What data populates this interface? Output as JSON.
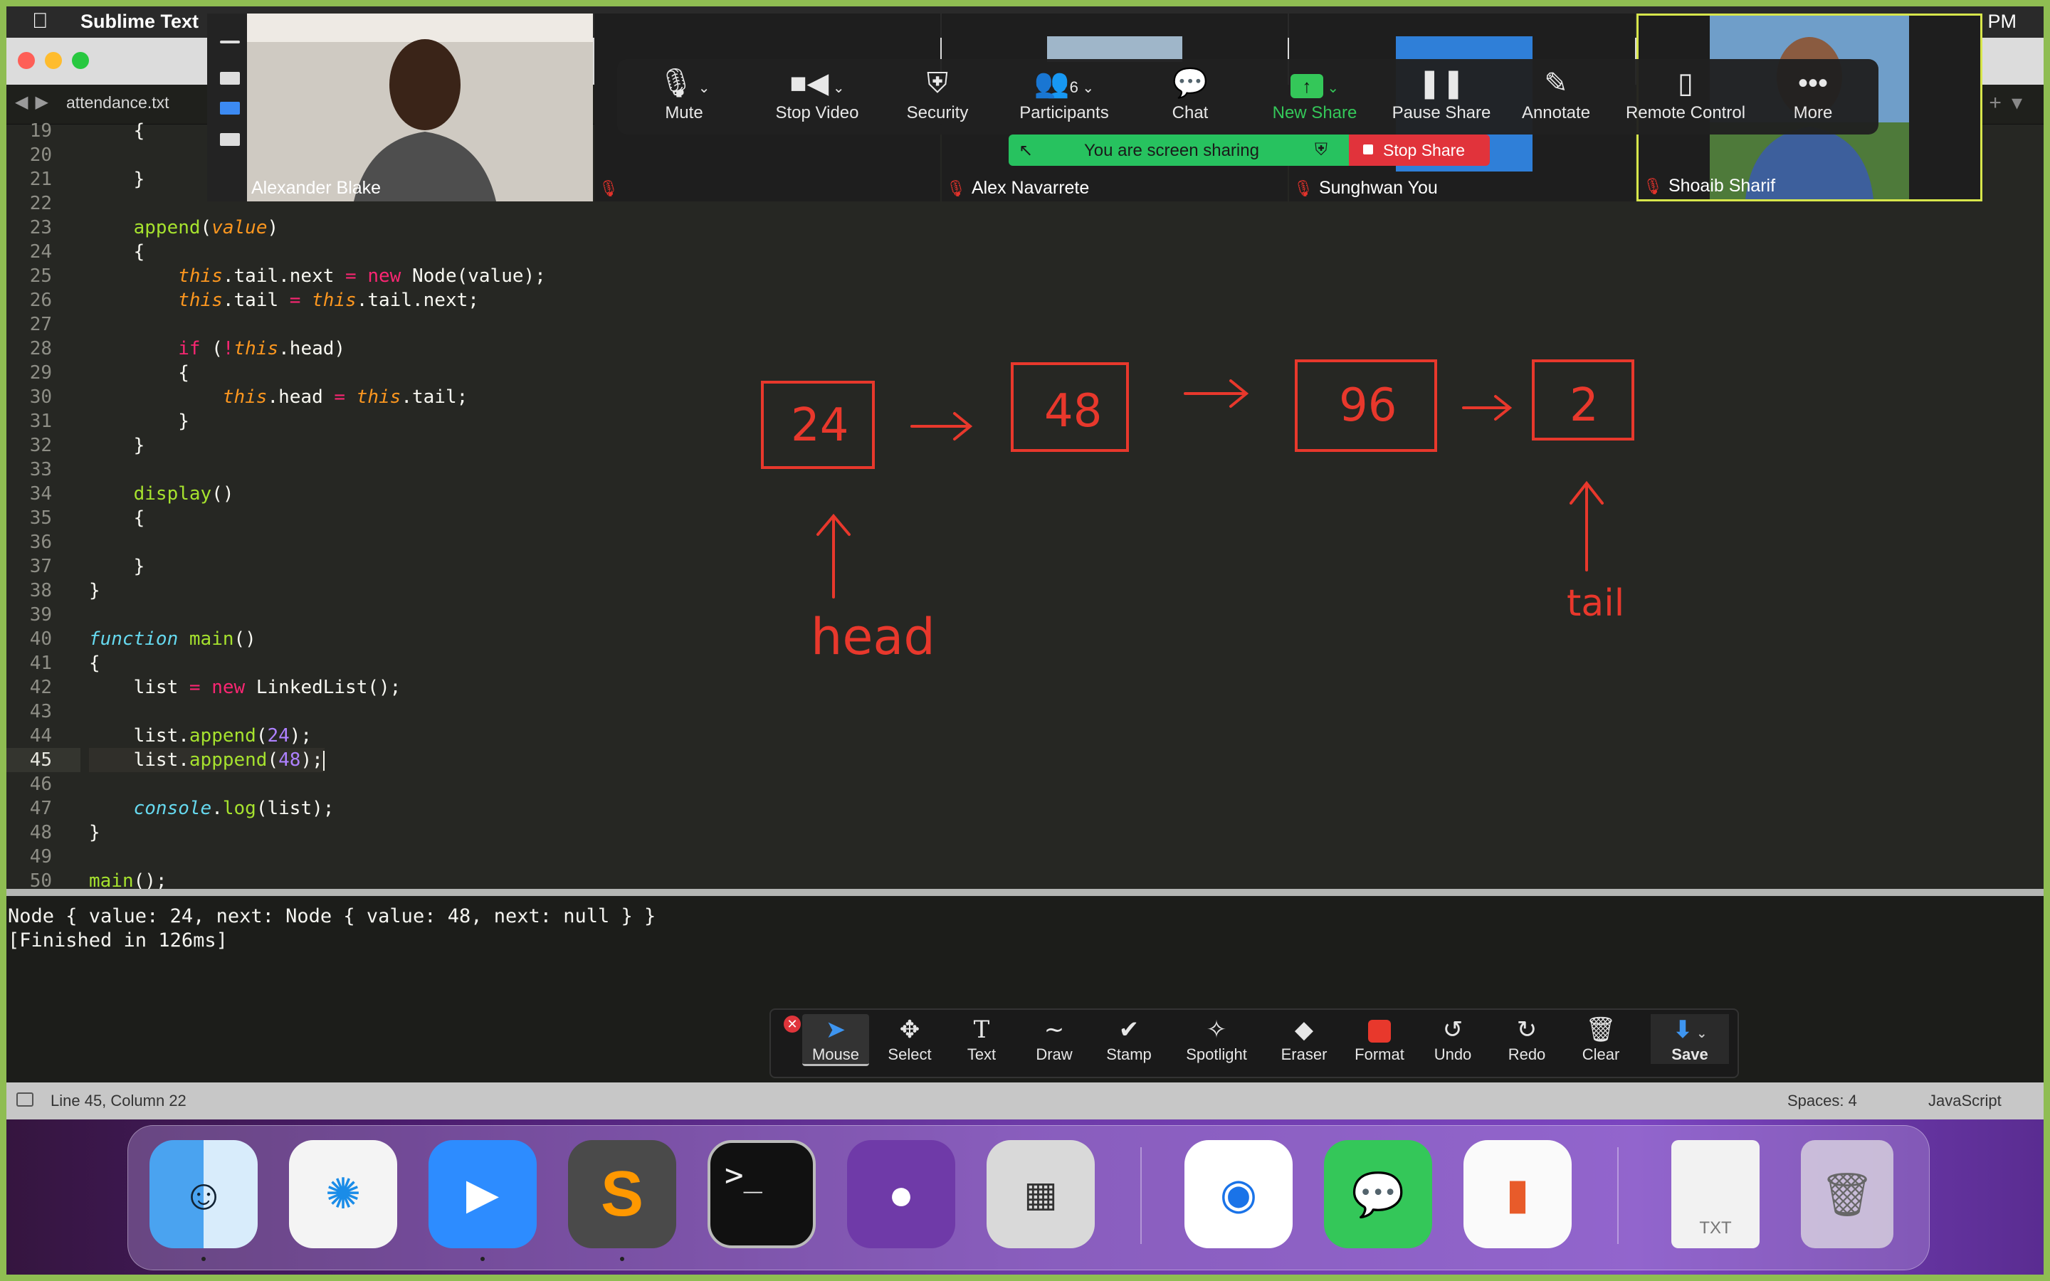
{
  "menubar": {
    "app_name": "Sublime Text",
    "clock": "3 PM"
  },
  "editor_tab": {
    "filename": "attendance.txt"
  },
  "code_lines": [
    {
      "n": "19",
      "html": "    {"
    },
    {
      "n": "20",
      "html": ""
    },
    {
      "n": "21",
      "html": "    }"
    },
    {
      "n": "22",
      "html": ""
    },
    {
      "n": "23",
      "html": "    <span class=\"fn\">append</span>(<span class=\"pa\">value</span>)"
    },
    {
      "n": "24",
      "html": "    {"
    },
    {
      "n": "25",
      "html": "        <span class=\"th\">this</span>.tail.next <span class=\"k\">=</span> <span class=\"k\">new</span> Node(value);"
    },
    {
      "n": "26",
      "html": "        <span class=\"th\">this</span>.tail <span class=\"k\">=</span> <span class=\"th\">this</span>.tail.next;"
    },
    {
      "n": "27",
      "html": ""
    },
    {
      "n": "28",
      "html": "        <span class=\"k\">if</span> (<span class=\"k\">!</span><span class=\"th\">this</span>.head)"
    },
    {
      "n": "29",
      "html": "        {"
    },
    {
      "n": "30",
      "html": "            <span class=\"th\">this</span>.head <span class=\"k\">=</span> <span class=\"th\">this</span>.tail;"
    },
    {
      "n": "31",
      "html": "        }"
    },
    {
      "n": "32",
      "html": "    }"
    },
    {
      "n": "33",
      "html": ""
    },
    {
      "n": "34",
      "html": "    <span class=\"fn\">display</span>()"
    },
    {
      "n": "35",
      "html": "    {"
    },
    {
      "n": "36",
      "html": ""
    },
    {
      "n": "37",
      "html": "    }"
    },
    {
      "n": "38",
      "html": "}"
    },
    {
      "n": "39",
      "html": ""
    },
    {
      "n": "40",
      "html": "<span class=\"it\">function</span> <span class=\"fn\">main</span>()"
    },
    {
      "n": "41",
      "html": "{"
    },
    {
      "n": "42",
      "html": "    list <span class=\"k\">=</span> <span class=\"k\">new</span> LinkedList();"
    },
    {
      "n": "43",
      "html": ""
    },
    {
      "n": "44",
      "html": "    list.<span class=\"fn\">append</span>(<span class=\"num\">24</span>);"
    },
    {
      "n": "45",
      "html": "    list.<span class=\"fn\">apppend</span>(<span class=\"num\">48</span>);<span class=\"cursor\"></span>"
    },
    {
      "n": "46",
      "html": ""
    },
    {
      "n": "47",
      "html": "    <span class=\"it\">console</span>.<span class=\"fn\">log</span>(list);"
    },
    {
      "n": "48",
      "html": "}"
    },
    {
      "n": "49",
      "html": ""
    },
    {
      "n": "50",
      "html": "<span class=\"fn\">main</span>();"
    }
  ],
  "current_line": "45",
  "output": {
    "line1": "Node { value: 24, next: Node { value: 48, next: null } }",
    "line2": "[Finished in 126ms]"
  },
  "statusbar": {
    "position": "Line 45, Column 22",
    "spaces": "Spaces: 4",
    "syntax": "JavaScript"
  },
  "drawing": {
    "nodes": [
      "24",
      "48",
      "96",
      "2"
    ],
    "head_label": "head",
    "tail_label": "tail",
    "ink_color": "#e8382c"
  },
  "participants": {
    "p1": "Alexander Blake",
    "p2": "Alex Navarrete",
    "p3": "Sunghwan You",
    "p4": "Shoaib Sharif",
    "count": "6"
  },
  "zoom_toolbar": {
    "mute": "Mute",
    "stop_video": "Stop Video",
    "security": "Security",
    "participants": "Participants",
    "chat": "Chat",
    "new_share": "New Share",
    "pause_share": "Pause Share",
    "annotate": "Annotate",
    "remote_control": "Remote Control",
    "more": "More"
  },
  "share_status": {
    "sharing": "You are screen sharing",
    "stop_share": "Stop Share"
  },
  "annotation_toolbar": {
    "mouse": "Mouse",
    "select": "Select",
    "text": "Text",
    "draw": "Draw",
    "stamp": "Stamp",
    "spotlight": "Spotlight",
    "eraser": "Eraser",
    "format": "Format",
    "undo": "Undo",
    "redo": "Redo",
    "clear": "Clear",
    "save": "Save"
  },
  "dock": {
    "txt_label": "TXT"
  },
  "colors": {
    "zoom_green": "#34c759",
    "stop_red": "#e1333b",
    "ink": "#e8382c",
    "frame_green": "#8fbd52"
  }
}
